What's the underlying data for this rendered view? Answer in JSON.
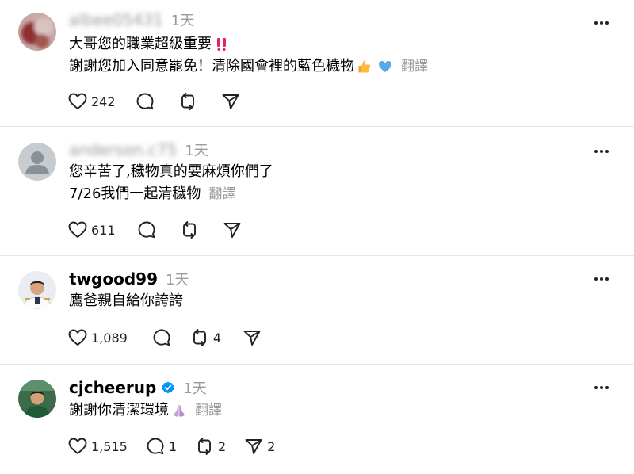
{
  "posts": [
    {
      "username": "albee05431",
      "time": "1天",
      "lines": [
        "大哥您的職業超級重要",
        "謝謝您加入同意罷免！清除國會裡的藍色穢物"
      ],
      "translate": "翻譯",
      "likes": "242",
      "comments": "",
      "reposts": "",
      "shares": ""
    },
    {
      "username": "anderson.c75",
      "time": "1天",
      "lines": [
        "您辛苦了,穢物真的要麻煩你們了",
        "7/26我們一起清穢物"
      ],
      "translate": "翻譯",
      "likes": "611",
      "comments": "",
      "reposts": "",
      "shares": ""
    },
    {
      "username": "twgood99",
      "time": "1天",
      "lines": [
        "鷹爸親自給你誇誇"
      ],
      "translate": "",
      "likes": "1,089",
      "comments": "",
      "reposts": "4",
      "shares": ""
    },
    {
      "username": "cjcheerup",
      "time": "1天",
      "lines": [
        "謝謝你清潔環境"
      ],
      "translate": "翻譯",
      "likes": "1,515",
      "comments": "1",
      "reposts": "2",
      "shares": "2"
    }
  ],
  "icons": {
    "like": "heart-icon",
    "comment": "comment-bubble-icon",
    "repost": "repost-icon",
    "share": "send-icon",
    "more": "more-horizontal-icon",
    "verified": "verified-badge-icon"
  },
  "colors": {
    "verified": "#0095f6",
    "muted": "#999999",
    "divider": "#e6e6e6"
  }
}
